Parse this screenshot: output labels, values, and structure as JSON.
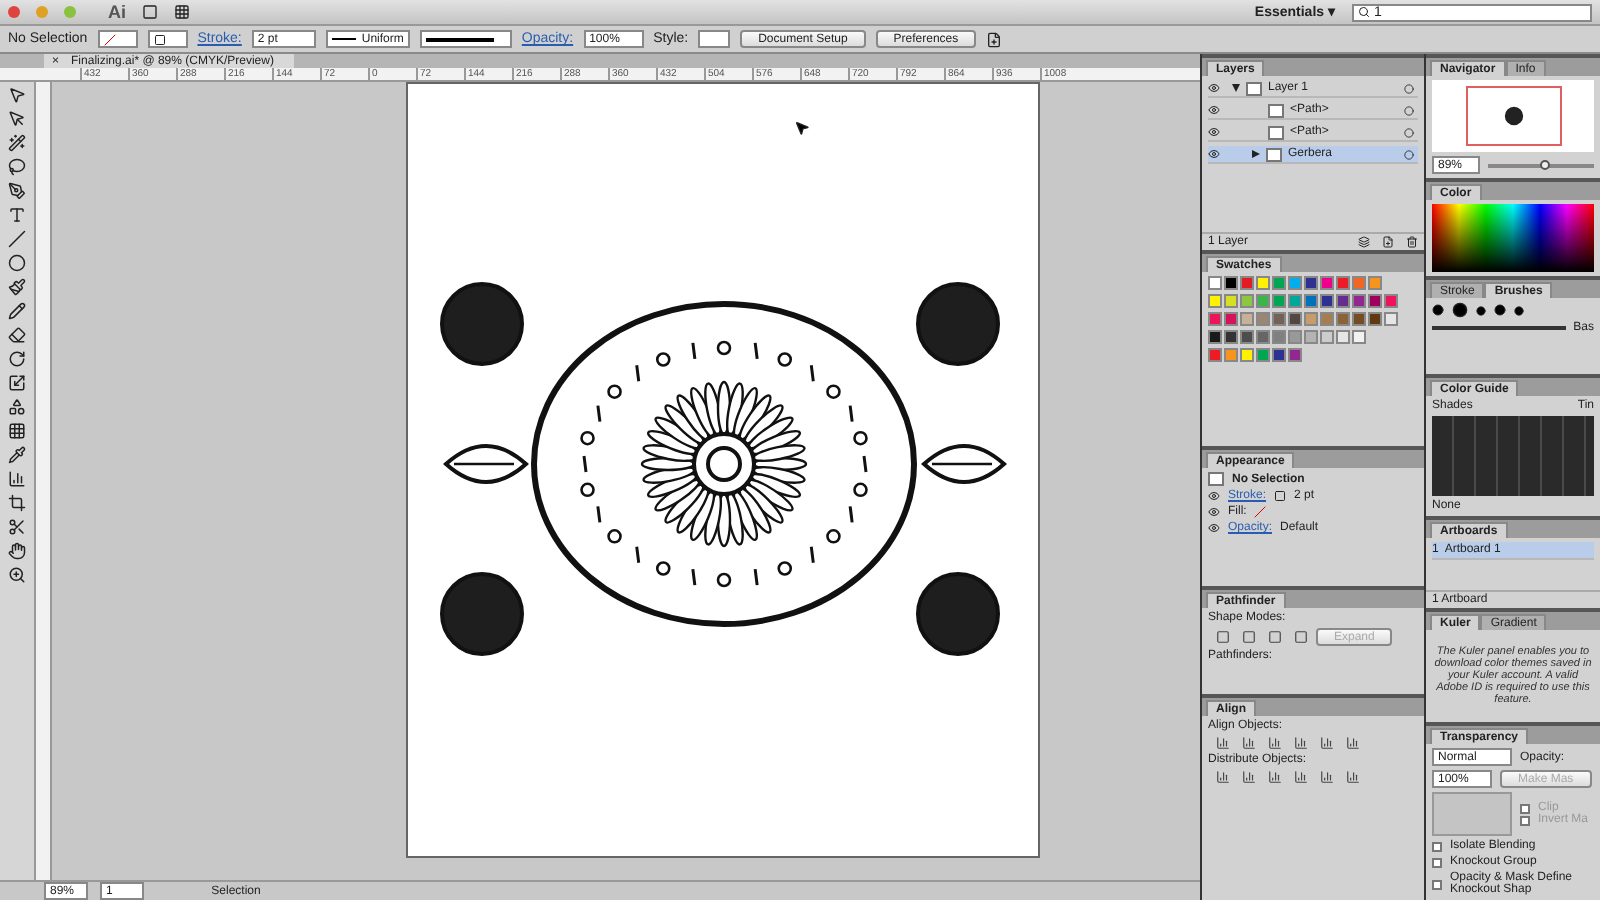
{
  "app_bar": {
    "logo": "Ai",
    "workspace": "Essentials",
    "workspace_caret": "▾",
    "search": "1"
  },
  "control_bar": {
    "selection": "No Selection",
    "stroke_label": "Stroke:",
    "stroke_value": "2 pt",
    "profile": "Uniform",
    "opacity_label": "Opacity:",
    "opacity_value": "100%",
    "style_label": "Style:",
    "buttons": [
      "Document Setup",
      "Preferences"
    ]
  },
  "document": {
    "close": "×",
    "title": "Finalizing.ai* @ 89% (CMYK/Preview)"
  },
  "ruler_ticks": [
    "432",
    "360",
    "288",
    "216",
    "144",
    "72",
    "0",
    "72",
    "144",
    "216",
    "288",
    "360",
    "432",
    "504",
    "576",
    "648",
    "720",
    "792",
    "864",
    "936",
    "1008"
  ],
  "status_bar": {
    "zoom": "89%",
    "artboard": "1",
    "tool": "Selection"
  },
  "layers": {
    "title": "Layers",
    "rows": [
      {
        "name": "Layer 1",
        "selected": false,
        "expanded": true,
        "children": [
          {
            "name": "<Path>",
            "selected": false
          },
          {
            "name": "<Path>",
            "selected": false
          },
          {
            "name": "Gerbera",
            "selected": true,
            "expanded": false
          }
        ]
      }
    ],
    "footer": "1 Layer"
  },
  "swatches": {
    "title": "Swatches",
    "rows": [
      [
        {
          "color": "#ffffff"
        },
        {
          "color": "#000000"
        },
        {
          "color": "#e31b23"
        },
        {
          "color": "#fff200"
        },
        {
          "color": "#00a651"
        },
        {
          "color": "#00aeef"
        },
        {
          "color": "#2e3192"
        },
        {
          "color": "#ec008c"
        },
        {
          "color": "#ed1c24"
        },
        {
          "color": "#f26522"
        },
        {
          "color": "#f7941d"
        }
      ],
      [
        {
          "color": "#fff200"
        },
        {
          "color": "#d7df23"
        },
        {
          "color": "#8dc63f"
        },
        {
          "color": "#39b54a"
        },
        {
          "color": "#00a651"
        },
        {
          "color": "#00a79d"
        },
        {
          "color": "#0072bc"
        },
        {
          "color": "#2e3192"
        },
        {
          "color": "#662d91"
        },
        {
          "color": "#92278f"
        },
        {
          "color": "#9e005d"
        },
        {
          "color": "#ed145b"
        }
      ],
      [
        {
          "color": "#ed145b"
        },
        {
          "color": "#d4145a"
        },
        {
          "color": "#c7b299"
        },
        {
          "color": "#998675"
        },
        {
          "color": "#736357"
        },
        {
          "color": "#534741"
        },
        {
          "color": "#c69c6d"
        },
        {
          "color": "#a67c52"
        },
        {
          "color": "#8c6239"
        },
        {
          "color": "#754c24"
        },
        {
          "color": "#603913"
        },
        {
          "color": "#e6e6e6"
        }
      ],
      [
        {
          "color": "#1a1a1a"
        },
        {
          "color": "#333333"
        },
        {
          "color": "#4d4d4d"
        },
        {
          "color": "#666666"
        },
        {
          "color": "#808080"
        },
        {
          "color": "#999999"
        },
        {
          "color": "#b3b3b3"
        },
        {
          "color": "#cccccc"
        },
        {
          "color": "#e6e6e6"
        },
        {
          "color": "#f2f2f2"
        }
      ],
      [
        {
          "color": "#ed1c24"
        },
        {
          "color": "#f7941d"
        },
        {
          "color": "#fff200"
        },
        {
          "color": "#00a651"
        },
        {
          "color": "#2e3192"
        },
        {
          "color": "#92278f"
        }
      ]
    ]
  },
  "appearance": {
    "title": "Appearance",
    "selection": "No Selection",
    "rows": [
      {
        "kind": "stroke",
        "label": "Stroke:",
        "value": "2 pt"
      },
      {
        "kind": "fill",
        "label": "Fill:"
      },
      {
        "kind": "opacity",
        "label": "Opacity:",
        "value": "Default"
      }
    ]
  },
  "pathfinder": {
    "title": "Pathfinder",
    "shape_modes": "Shape Modes:",
    "expand": {
      "label": "Expand",
      "disabled": true
    },
    "pathfinders": "Pathfinders:"
  },
  "align": {
    "title": "Align",
    "align_objects": "Align Objects:",
    "distribute_objects": "Distribute Objects:"
  },
  "navigator": {
    "tabs": [
      {
        "label": "Navigator",
        "selected": true
      },
      {
        "label": "Info",
        "selected": false
      }
    ],
    "zoom": "89%",
    "level": 0.55
  },
  "color": {
    "title": "Color"
  },
  "brushes": {
    "tabs": [
      {
        "label": "Stroke",
        "selected": false
      },
      {
        "label": "Brushes",
        "selected": true
      }
    ],
    "basic": "Bas"
  },
  "color_guide": {
    "title": "Color Guide",
    "shades": "Shades",
    "tints": "Tin",
    "none": "None"
  },
  "artboards": {
    "title": "Artboards",
    "rows": [
      {
        "number": "1",
        "name": "Artboard 1",
        "selected": true
      }
    ],
    "footer": "1 Artboard"
  },
  "kuler": {
    "tabs": [
      {
        "label": "Kuler",
        "selected": true
      },
      {
        "label": "Gradient",
        "selected": false
      }
    ],
    "message": "The Kuler panel enables you to download color themes saved in your Kuler account. A valid Adobe ID is required to use this feature."
  },
  "transparency": {
    "title": "Transparency",
    "blend_mode": "Normal",
    "opacity_label": "Opacity:",
    "opacity_value": "100%",
    "make_mask": {
      "label": "Make Mas",
      "disabled": true
    },
    "options": [
      {
        "label": "Clip",
        "checked": false,
        "disabled": true
      },
      {
        "label": "Invert Ma",
        "checked": false,
        "disabled": true
      }
    ],
    "checkboxes": [
      {
        "label": "Isolate Blending",
        "checked": false
      },
      {
        "label": "Knockout Group",
        "checked": false
      },
      {
        "label": "Opacity & Mask Define Knockout Shap",
        "checked": false
      }
    ]
  }
}
